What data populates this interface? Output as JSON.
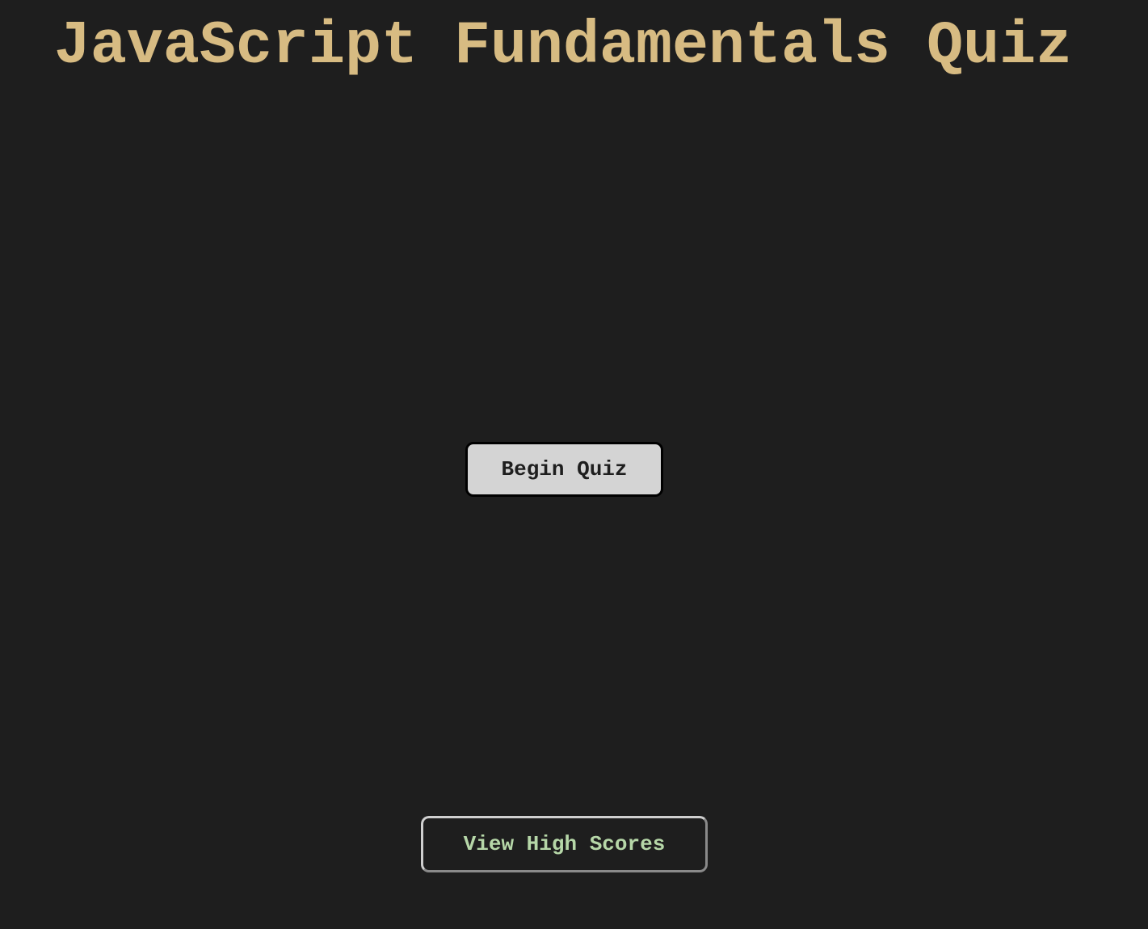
{
  "header": {
    "title": "JavaScript Fundamentals Quiz"
  },
  "main": {
    "begin_label": "Begin Quiz"
  },
  "footer": {
    "high_scores_label": "View High Scores"
  },
  "colors": {
    "background": "#1e1e1e",
    "title": "#d7bb82",
    "begin_button_bg": "#d4d4d4",
    "high_scores_text": "#b6d7a8"
  }
}
